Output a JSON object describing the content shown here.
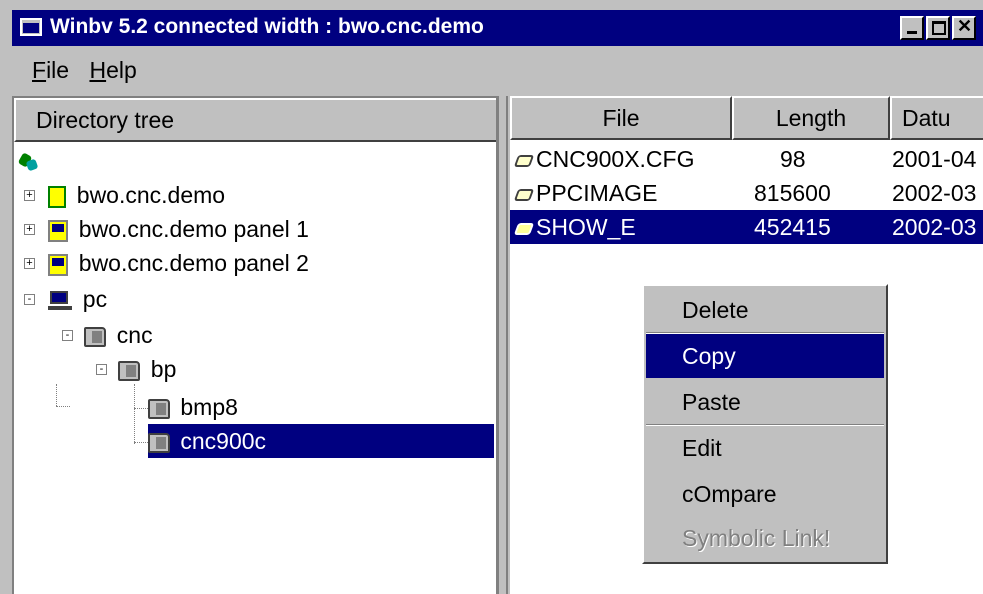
{
  "window": {
    "title": "Winbv 5.2 connected width : bwo.cnc.demo"
  },
  "menu": [
    {
      "accel": "F",
      "rest": "ile"
    },
    {
      "accel": "H",
      "rest": "elp"
    }
  ],
  "tree": {
    "header": "Directory tree",
    "nodes": [
      {
        "label": "",
        "icon": "network-icon"
      },
      {
        "label": "bwo.cnc.demo",
        "icon": "device-icon",
        "expander": "+"
      },
      {
        "label": "bwo.cnc.demo panel 1",
        "icon": "panel-icon",
        "expander": "+"
      },
      {
        "label": "bwo.cnc.demo panel 2",
        "icon": "panel-icon",
        "expander": "+"
      },
      {
        "label": "pc",
        "icon": "pc-icon",
        "expander": "-"
      },
      {
        "label": "cnc",
        "icon": "folder-icon",
        "expander": "-"
      },
      {
        "label": "bp",
        "icon": "folder-icon",
        "expander": "-"
      },
      {
        "label": "bmp8",
        "icon": "folder-icon"
      },
      {
        "label": "cnc900c",
        "icon": "folder-icon",
        "selected": true
      }
    ]
  },
  "files": {
    "columns": [
      "File",
      "Length",
      "Datu"
    ],
    "rows": [
      {
        "name": "CNC900X.CFG",
        "length": "98",
        "date": "2001-04"
      },
      {
        "name": "PPCIMAGE",
        "length": "815600",
        "date": "2002-03"
      },
      {
        "name": "SHOW_E",
        "length": "452415",
        "date": "2002-03",
        "selected": true
      }
    ]
  },
  "context_menu": {
    "items": [
      "Delete",
      "Copy",
      "Paste",
      "Edit",
      "cOmpare",
      "Symbolic Link!"
    ],
    "active": "Copy",
    "disabled": "Symbolic Link!"
  },
  "colors": {
    "selection": "#000080",
    "face": "#c0c0c0"
  }
}
